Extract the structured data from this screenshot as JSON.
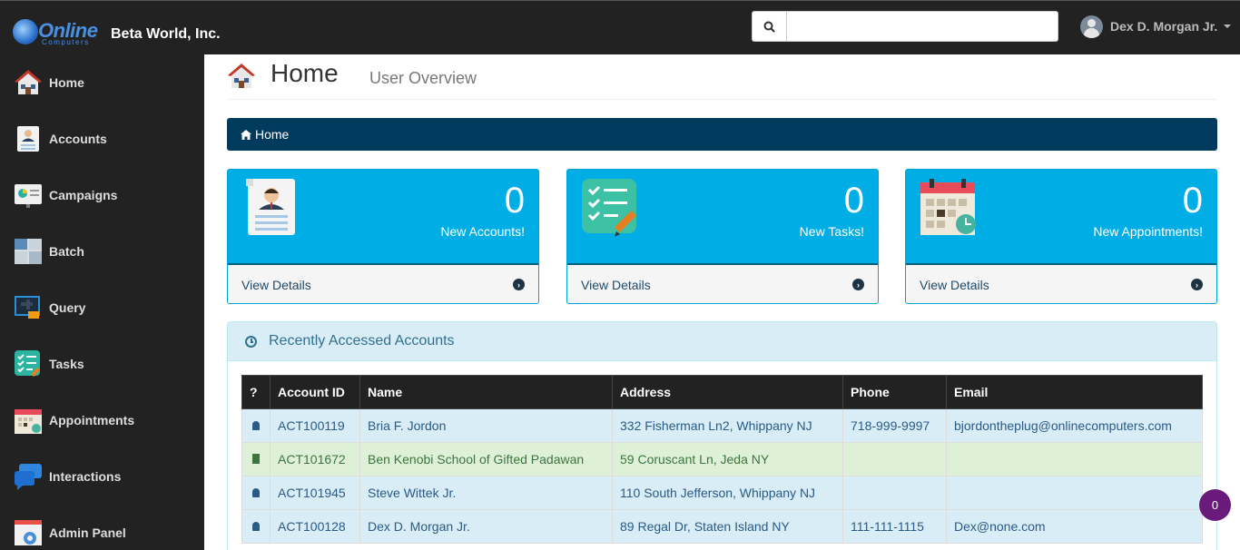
{
  "header": {
    "logo_text": "Online",
    "logo_sub": "Computers",
    "company": "Beta World, Inc.",
    "search": {
      "value": "",
      "placeholder": ""
    },
    "user_name": "Dex D. Morgan Jr."
  },
  "sidebar": {
    "items": [
      {
        "label": "Home",
        "icon": "home-icon"
      },
      {
        "label": "Accounts",
        "icon": "accounts-icon"
      },
      {
        "label": "Campaigns",
        "icon": "campaigns-icon"
      },
      {
        "label": "Batch",
        "icon": "batch-icon"
      },
      {
        "label": "Query",
        "icon": "query-icon"
      },
      {
        "label": "Tasks",
        "icon": "tasks-icon"
      },
      {
        "label": "Appointments",
        "icon": "appointments-icon"
      },
      {
        "label": "Interactions",
        "icon": "interactions-icon"
      },
      {
        "label": "Admin Panel",
        "icon": "admin-panel-icon"
      }
    ]
  },
  "page": {
    "title": "Home",
    "subtitle": "User Overview",
    "breadcrumb": "Home"
  },
  "cards": [
    {
      "count": "0",
      "label": "New Accounts!",
      "footer": "View Details",
      "icon": "new-accounts-icon"
    },
    {
      "count": "0",
      "label": "New Tasks!",
      "footer": "View Details",
      "icon": "new-tasks-icon"
    },
    {
      "count": "0",
      "label": "New Appointments!",
      "footer": "View Details",
      "icon": "new-appointments-icon"
    }
  ],
  "recent": {
    "title": "Recently Accessed Accounts",
    "columns": [
      "?",
      "Account ID",
      "Name",
      "Address",
      "Phone",
      "Email"
    ],
    "rows": [
      {
        "type": "person",
        "id": "ACT100119",
        "name": "Bria F. Jordon",
        "address": "332 Fisherman Ln2, Whippany NJ",
        "phone": "718-999-9997",
        "email": "bjordontheplug@onlinecomputers.com"
      },
      {
        "type": "business",
        "id": "ACT101672",
        "name": "Ben Kenobi School of Gifted Padawan",
        "address": "59 Coruscant Ln, Jeda NY",
        "phone": "",
        "email": ""
      },
      {
        "type": "person",
        "id": "ACT101945",
        "name": "Steve Wittek Jr.",
        "address": "110 South Jefferson, Whippany NJ",
        "phone": "",
        "email": ""
      },
      {
        "type": "person",
        "id": "ACT100128",
        "name": "Dex D. Morgan Jr.",
        "address": "89 Regal Dr, Staten Island NY",
        "phone": "111-111-1115",
        "email": "Dex@none.com"
      }
    ]
  },
  "fab": {
    "label": "0"
  },
  "colors": {
    "topbar": "#222222",
    "breadcrumb": "#003a5c",
    "card": "#00aee5",
    "panel_head": "#d9edf7",
    "fab": "#6a1a7a"
  }
}
